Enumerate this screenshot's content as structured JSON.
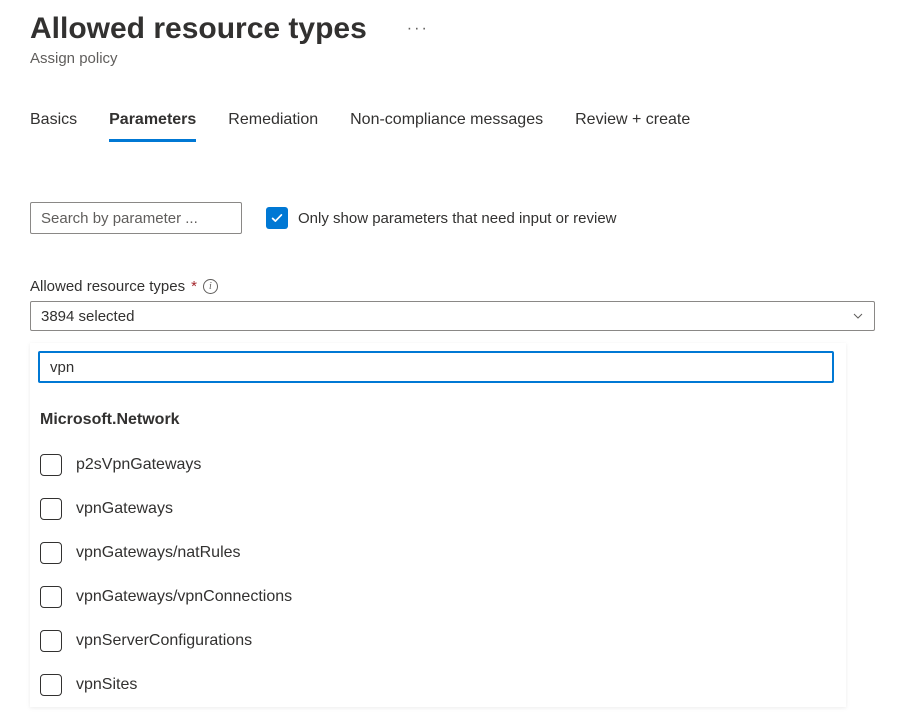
{
  "header": {
    "title": "Allowed resource types",
    "subtitle": "Assign policy"
  },
  "tabs": [
    {
      "label": "Basics",
      "active": false
    },
    {
      "label": "Parameters",
      "active": true
    },
    {
      "label": "Remediation",
      "active": false
    },
    {
      "label": "Non-compliance messages",
      "active": false
    },
    {
      "label": "Review + create",
      "active": false
    }
  ],
  "search": {
    "placeholder": "Search by parameter ..."
  },
  "only_show": {
    "checked": true,
    "label": "Only show parameters that need input or review"
  },
  "field": {
    "label": "Allowed resource types",
    "selected_text": "3894 selected"
  },
  "dropdown": {
    "filter_value": "vpn",
    "group": "Microsoft.Network",
    "options": [
      {
        "label": "p2sVpnGateways"
      },
      {
        "label": "vpnGateways"
      },
      {
        "label": "vpnGateways/natRules"
      },
      {
        "label": "vpnGateways/vpnConnections"
      },
      {
        "label": "vpnServerConfigurations"
      },
      {
        "label": "vpnSites"
      }
    ]
  }
}
